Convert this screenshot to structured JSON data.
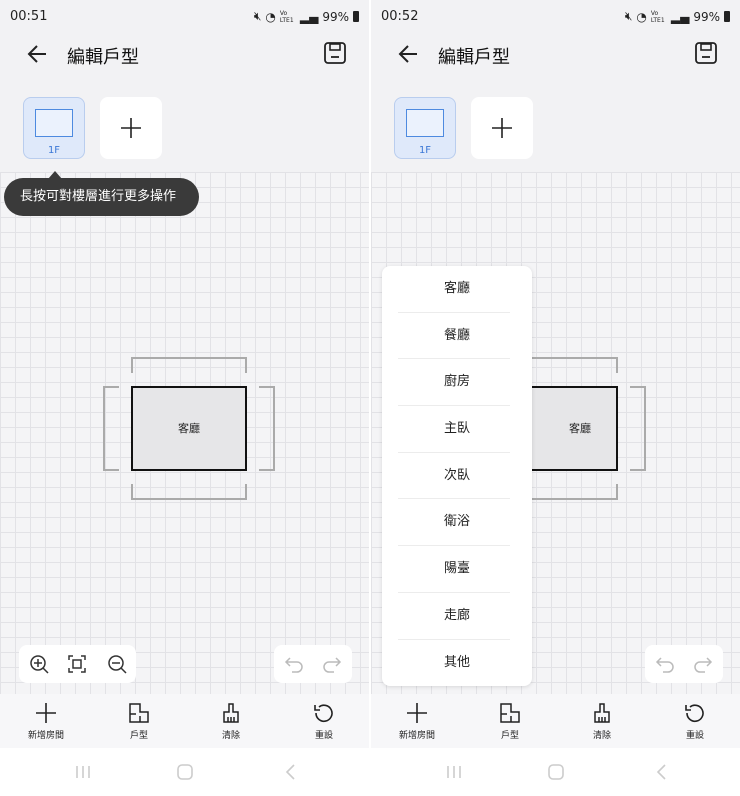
{
  "left": {
    "status": {
      "time": "00:51",
      "battery": "99%",
      "net": "Vo LTE1"
    },
    "appbar": {
      "title": "編輯戶型"
    },
    "floor": {
      "label": "1F"
    },
    "tooltip": "長按可對樓層進行更多操作",
    "room": {
      "label": "客廳"
    },
    "bottom": [
      {
        "icon": "plus-icon",
        "label": "新增房間"
      },
      {
        "icon": "floorplan-icon",
        "label": "戶型"
      },
      {
        "icon": "broom-icon",
        "label": "清除"
      },
      {
        "icon": "reset-icon",
        "label": "重設"
      }
    ]
  },
  "right": {
    "status": {
      "time": "00:52",
      "battery": "99%",
      "net": "Vo LTE1"
    },
    "appbar": {
      "title": "編輯戶型"
    },
    "floor": {
      "label": "1F"
    },
    "room": {
      "label": "客廳"
    },
    "menu": [
      "客廳",
      "餐廳",
      "廚房",
      "主臥",
      "次臥",
      "衛浴",
      "陽臺",
      "走廊",
      "其他"
    ],
    "bottom": [
      {
        "icon": "plus-icon",
        "label": "新增房間"
      },
      {
        "icon": "floorplan-icon",
        "label": "戶型"
      },
      {
        "icon": "broom-icon",
        "label": "清除"
      },
      {
        "icon": "reset-icon",
        "label": "重設"
      }
    ]
  },
  "colors": {
    "accent": "#3b78d6",
    "tile_bg": "#dfe9fa",
    "tooltip_bg": "#3a3a3a"
  }
}
